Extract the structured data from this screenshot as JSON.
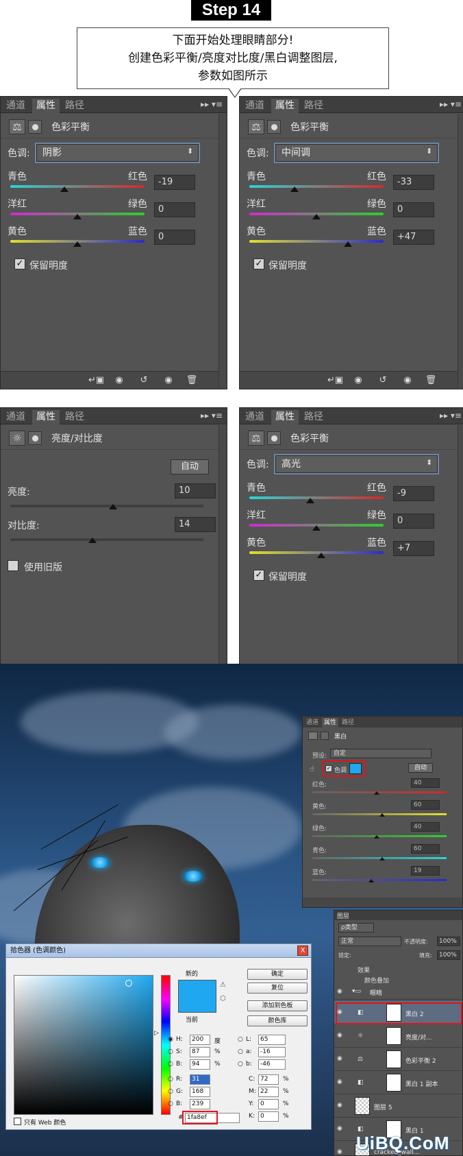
{
  "step_title": "Step 14",
  "callout": {
    "line1": "下面开始处理眼睛部分!",
    "line2": "创建色彩平衡/亮度对比度/黑白调整图层,",
    "line3": "参数如图所示"
  },
  "tabs": [
    "通道",
    "属性",
    "路径"
  ],
  "panel_icons": [
    "▸▸",
    "▾≡"
  ],
  "color_balance_title": "色彩平衡",
  "tone_label": "色调:",
  "slider_labels": {
    "cyan": "青色",
    "red": "红色",
    "magenta": "洋红",
    "green": "绿色",
    "yellow": "黄色",
    "blue": "蓝色"
  },
  "preserve_luminosity": "保留明度",
  "panels": {
    "shadows": {
      "tone": "阴影",
      "values": [
        "-19",
        "0",
        "0"
      ],
      "positions": [
        -19,
        0,
        0
      ]
    },
    "midtones": {
      "tone": "中间调",
      "values": [
        "-33",
        "0",
        "+47"
      ],
      "positions": [
        -33,
        0,
        47
      ]
    },
    "highlights": {
      "tone": "高光",
      "values": [
        "-9",
        "0",
        "+7"
      ],
      "positions": [
        -9,
        0,
        7
      ]
    }
  },
  "brightness_contrast": {
    "title": "亮度/对比度",
    "auto_label": "自动",
    "brightness_label": "亮度:",
    "brightness_value": "10",
    "brightness": 10,
    "contrast_label": "对比度:",
    "contrast_value": "14",
    "contrast": 14,
    "legacy_label": "使用旧版"
  },
  "black_white": {
    "tabs": [
      "通道",
      "属性",
      "路径"
    ],
    "title": "黑白",
    "preset_label": "预设:",
    "preset_value": "自定",
    "tint_label": "色调",
    "auto_label": "自动",
    "channels": [
      {
        "label": "红色:",
        "value": "40",
        "level": 40
      },
      {
        "label": "黄色:",
        "value": "60",
        "level": 60
      },
      {
        "label": "绿色:",
        "value": "40",
        "level": 40
      },
      {
        "label": "青色:",
        "value": "60",
        "level": 60
      },
      {
        "label": "蓝色:",
        "value": "19",
        "level": 19
      }
    ]
  },
  "layers_panel": {
    "tab": "图层",
    "kind_label": "ρ类型",
    "blend_mode": "正常",
    "opacity_label": "不透明度:",
    "opacity_value": "100%",
    "lock_label": "锁定:",
    "fill_label": "填充:",
    "fill_value": "100%",
    "effects_label": "效果",
    "color_overlay_label": "颜色叠加",
    "group_label": "眼睛",
    "layers": [
      "黑白 2",
      "亮度/对...",
      "色彩平衡 2",
      "黑白 1 副本",
      "图层 5",
      "黑白 1",
      "cracked_wall..."
    ]
  },
  "color_picker": {
    "title": "拾色器 (色调颜色)",
    "close": "X",
    "new_label": "新的",
    "current_label": "当前",
    "ok": "确定",
    "reset": "复位",
    "add_swatch": "添加到色板",
    "libraries": "颜色库",
    "web_only": "只有 Web 颜色",
    "hsb": [
      {
        "label": "H:",
        "value": "200",
        "unit": "度"
      },
      {
        "label": "S:",
        "value": "87",
        "unit": "%"
      },
      {
        "label": "B:",
        "value": "94",
        "unit": "%"
      }
    ],
    "rgb": [
      {
        "label": "R:",
        "value": "31"
      },
      {
        "label": "G:",
        "value": "168"
      },
      {
        "label": "B:",
        "value": "239"
      }
    ],
    "lab": [
      {
        "label": "L:",
        "value": "65"
      },
      {
        "label": "a:",
        "value": "-16"
      },
      {
        "label": "b:",
        "value": "-46"
      }
    ],
    "cmyk": [
      {
        "label": "C:",
        "value": "72",
        "unit": "%"
      },
      {
        "label": "M:",
        "value": "22",
        "unit": "%"
      },
      {
        "label": "Y:",
        "value": "0",
        "unit": "%"
      },
      {
        "label": "K:",
        "value": "0",
        "unit": "%"
      }
    ],
    "hex_label": "#",
    "hex": "1fa8ef"
  },
  "watermark": "UiBQ.CoM",
  "colors": {
    "accent": "#1fa8ef",
    "highlight_box": "#e0141b",
    "panel_bg": "#535353"
  }
}
